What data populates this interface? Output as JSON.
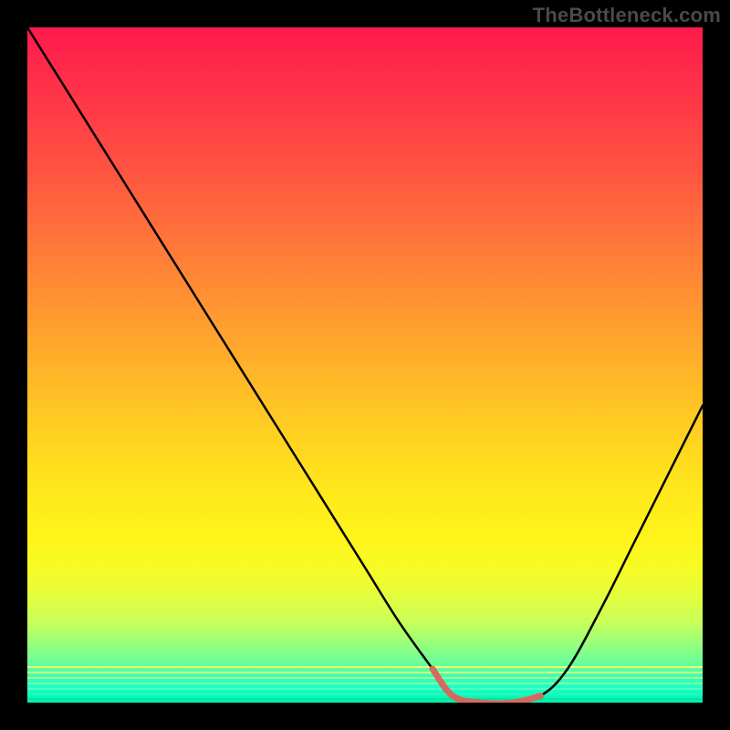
{
  "watermark": "TheBottleneck.com",
  "colors": {
    "frame_bg": "#000000",
    "curve_main": "#000000",
    "curve_accent": "#d46a5e",
    "watermark_text": "#4a4a4a"
  },
  "chart_data": {
    "type": "line",
    "title": "",
    "xlabel": "",
    "ylabel": "",
    "xlim": [
      0,
      100
    ],
    "ylim": [
      0,
      100
    ],
    "grid": false,
    "legend": false,
    "series": [
      {
        "name": "bottleneck-curve",
        "x": [
          0,
          5,
          10,
          15,
          20,
          25,
          30,
          35,
          40,
          45,
          50,
          55,
          60,
          63,
          67,
          72,
          76,
          80,
          85,
          90,
          95,
          100
        ],
        "values": [
          100,
          92,
          84,
          76,
          68,
          60,
          52,
          44,
          36,
          28,
          20,
          12,
          5,
          1,
          0,
          0,
          1,
          5,
          14,
          24,
          34,
          44
        ]
      }
    ],
    "accent_segment": {
      "name": "flat-minimum-highlight",
      "x": [
        60,
        63,
        67,
        72,
        76
      ],
      "values": [
        5,
        1,
        0,
        0,
        1
      ]
    },
    "gradient_stops": [
      {
        "pos": 0.0,
        "hex": "#ff1a4d"
      },
      {
        "pos": 0.2,
        "hex": "#ff5042"
      },
      {
        "pos": 0.44,
        "hex": "#ff9e2f"
      },
      {
        "pos": 0.68,
        "hex": "#ffe61c"
      },
      {
        "pos": 0.88,
        "hex": "#c8ff58"
      },
      {
        "pos": 1.0,
        "hex": "#00f0a8"
      }
    ]
  }
}
